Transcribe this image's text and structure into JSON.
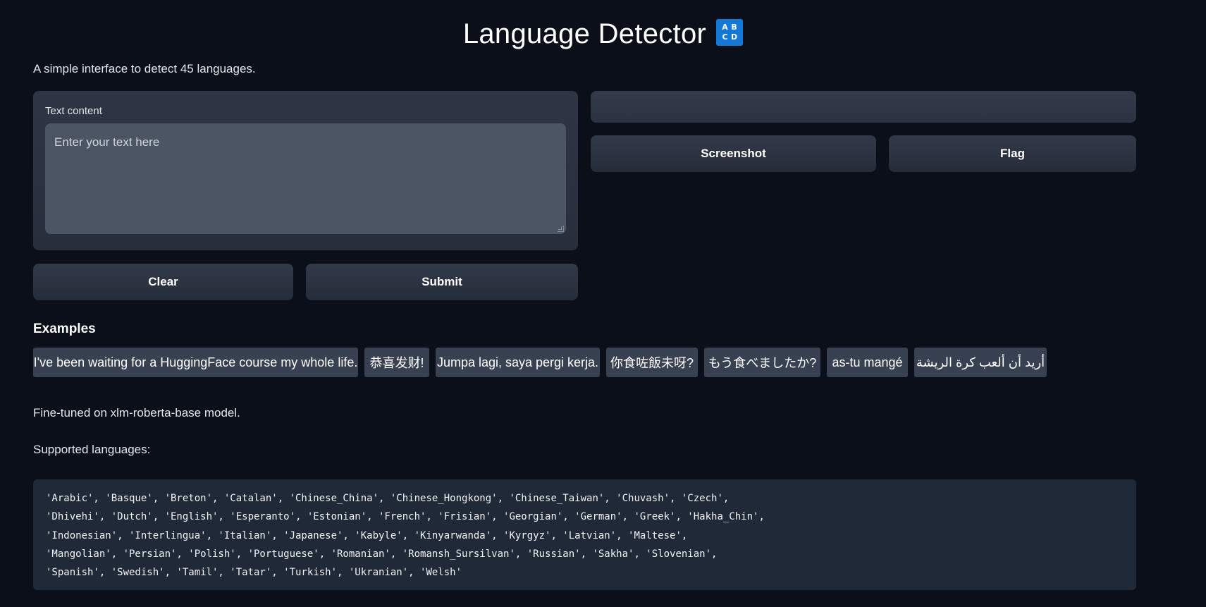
{
  "header": {
    "title": "Language Detector",
    "icon_letters": [
      "A",
      "B",
      "C",
      "D"
    ],
    "icon_name": "abcd-input-symbol-icon",
    "icon_color": "#1479d6"
  },
  "description": "A simple interface to detect 45 languages.",
  "input": {
    "label": "Text content",
    "placeholder": "Enter your text here"
  },
  "buttons": {
    "clear": "Clear",
    "submit": "Submit",
    "screenshot": "Screenshot",
    "flag": "Flag"
  },
  "examples": {
    "heading": "Examples",
    "items": [
      "I've been waiting for a HuggingFace course my whole life.",
      "恭喜发财!",
      "Jumpa lagi, saya pergi kerja.",
      "你食咗飯未呀?",
      "もう食べましたか?",
      "as-tu mangé",
      "أريد أن ألعب كرة الريشة"
    ]
  },
  "article": {
    "model_note": "Fine-tuned on xlm-roberta-base model.",
    "languages_heading": "Supported languages:",
    "languages_lines": [
      "'Arabic', 'Basque', 'Breton', 'Catalan', 'Chinese_China', 'Chinese_Hongkong', 'Chinese_Taiwan', 'Chuvash', 'Czech',",
      "'Dhivehi', 'Dutch', 'English', 'Esperanto', 'Estonian', 'French', 'Frisian', 'Georgian', 'German', 'Greek', 'Hakha_Chin',",
      "'Indonesian', 'Interlingua', 'Italian', 'Japanese', 'Kabyle', 'Kinyarwanda', 'Kyrgyz', 'Latvian', 'Maltese',",
      "'Mangolian', 'Persian', 'Polish', 'Portuguese', 'Romanian', 'Romansh_Sursilvan', 'Russian', 'Sakha', 'Slovenian',",
      "'Spanish', 'Swedish', 'Tamil', 'Tatar', 'Turkish', 'Ukranian', 'Welsh'"
    ]
  },
  "theme": {
    "background": "#0b0f19",
    "panel": "#2e3545",
    "textarea": "#4b5563",
    "example_chip": "#374151",
    "code_background": "#1f2937"
  }
}
